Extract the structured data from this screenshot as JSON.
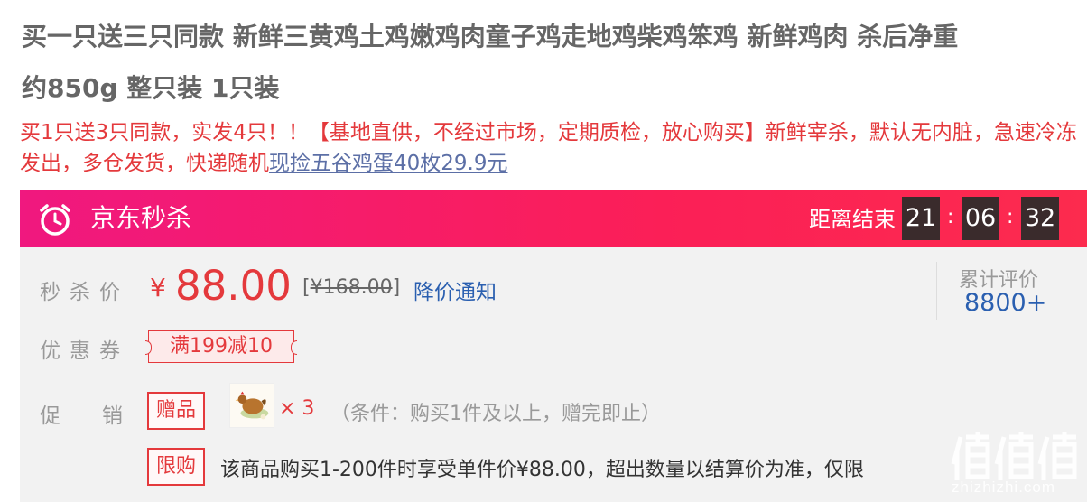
{
  "product": {
    "title_line1": "买一只送三只同款 新鲜三黄鸡土鸡嫩鸡肉童子鸡走地鸡柴鸡笨鸡 新鲜鸡肉 杀后净重",
    "title_line2": "约850g 整只装 1只装",
    "promo_text": "买1只送3只同款，实发4只！！【基地直供，不经过市场，定期质检，放心购买】新鲜宰杀，默认无内脏，急速冷冻发出，多仓发货，快递随机",
    "promo_link": "现捡五谷鸡蛋40枚29.9元"
  },
  "seckill": {
    "title": "京东秒杀",
    "countdown_label": "距离结束",
    "hours": "21",
    "minutes": "06",
    "seconds": "32",
    "sep": ":"
  },
  "price": {
    "label": "秒杀价",
    "currency": "¥",
    "value": "88.00",
    "original_open": "[",
    "original": "¥168.00",
    "original_close": "]",
    "notify": "降价通知"
  },
  "reviews": {
    "label": "累计评价",
    "count": "8800+"
  },
  "coupon": {
    "label": "优惠券",
    "text": "满199减10"
  },
  "promotion": {
    "label": "促销",
    "gift_tag": "赠品",
    "gift_qty": "× 3",
    "gift_condition": "（条件：购买1件及以上，赠完即止）",
    "limit_tag": "限购",
    "limit_text": "该商品购买1-200件时享受单件价¥88.00，超出数量以结算价为准，仅限"
  },
  "watermark": {
    "text": "zhizhizhi.com",
    "icon": "zhi-logo"
  },
  "colors": {
    "accent": "#e4393c",
    "bar_start": "#f0187f",
    "bar_end": "#fc2b4e",
    "link": "#2a5fb0"
  }
}
